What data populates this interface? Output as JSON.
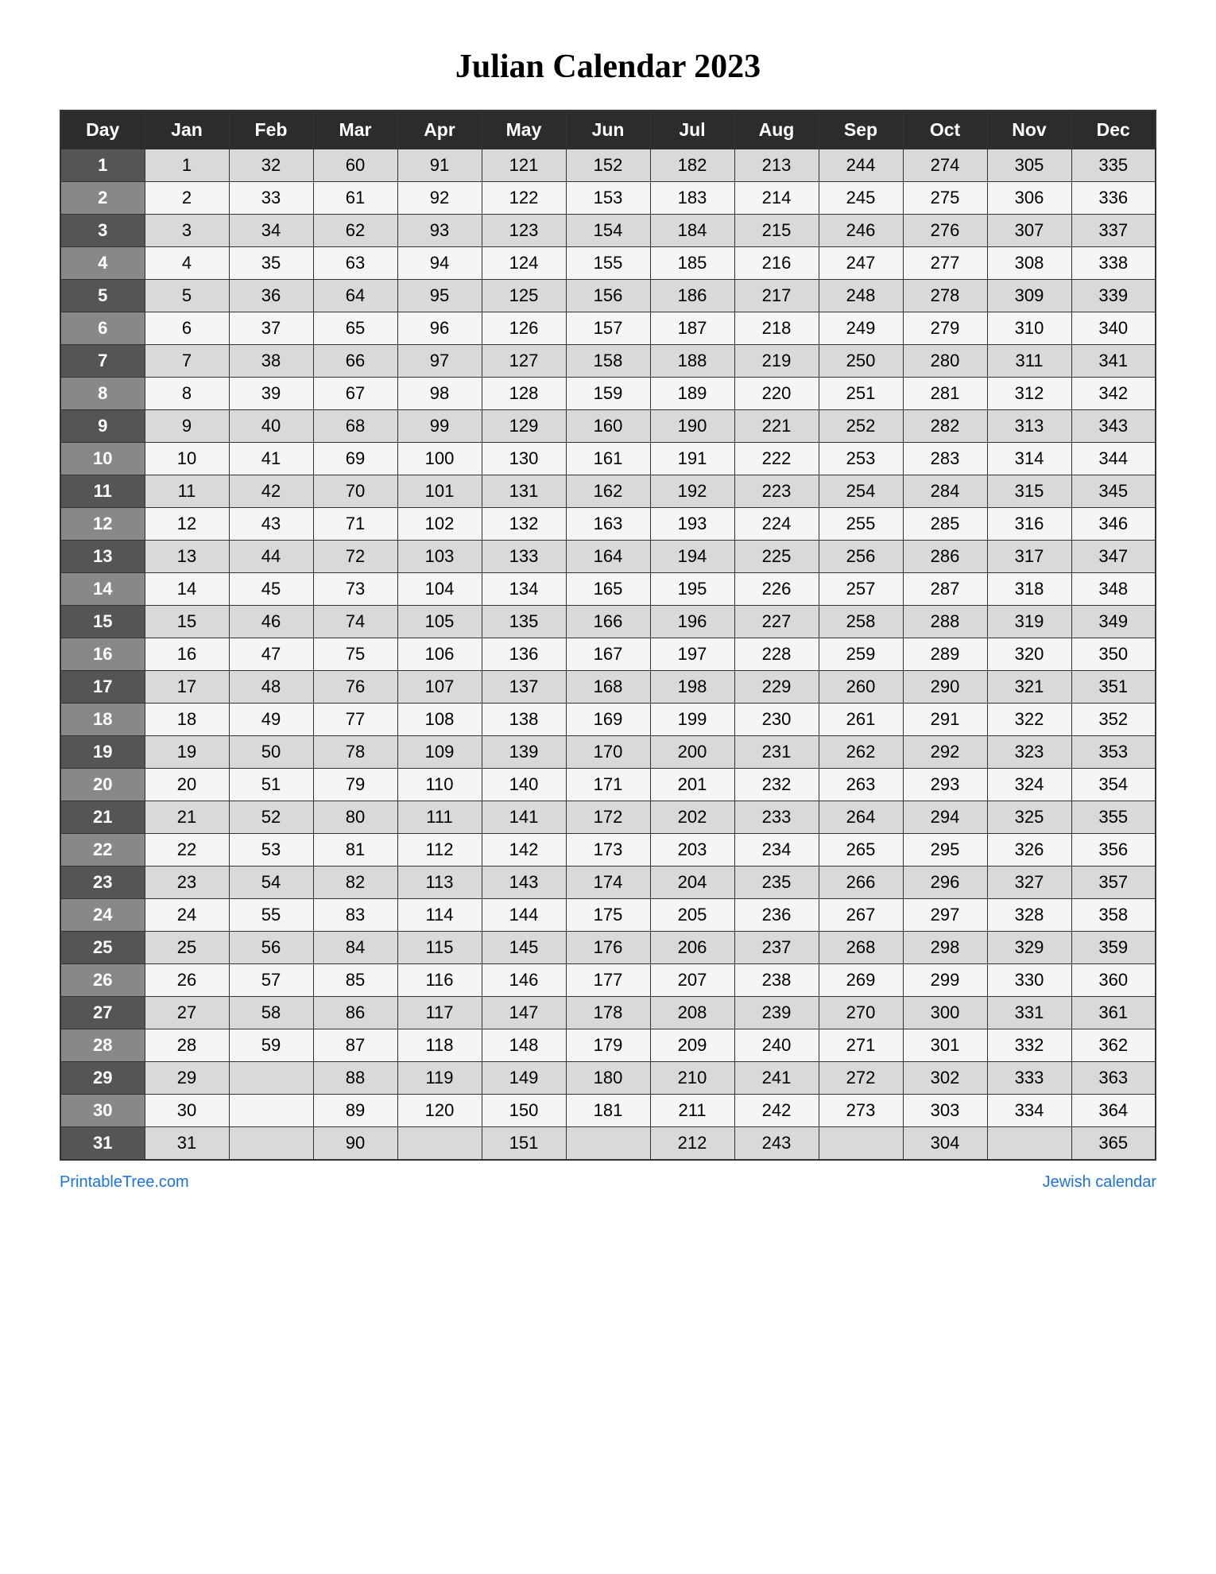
{
  "title": "Julian Calendar 2023",
  "headers": [
    "Day",
    "Jan",
    "Feb",
    "Mar",
    "Apr",
    "May",
    "Jun",
    "Jul",
    "Aug",
    "Sep",
    "Oct",
    "Nov",
    "Dec"
  ],
  "rows": [
    [
      1,
      1,
      32,
      60,
      91,
      121,
      152,
      182,
      213,
      244,
      274,
      305,
      335
    ],
    [
      2,
      2,
      33,
      61,
      92,
      122,
      153,
      183,
      214,
      245,
      275,
      306,
      336
    ],
    [
      3,
      3,
      34,
      62,
      93,
      123,
      154,
      184,
      215,
      246,
      276,
      307,
      337
    ],
    [
      4,
      4,
      35,
      63,
      94,
      124,
      155,
      185,
      216,
      247,
      277,
      308,
      338
    ],
    [
      5,
      5,
      36,
      64,
      95,
      125,
      156,
      186,
      217,
      248,
      278,
      309,
      339
    ],
    [
      6,
      6,
      37,
      65,
      96,
      126,
      157,
      187,
      218,
      249,
      279,
      310,
      340
    ],
    [
      7,
      7,
      38,
      66,
      97,
      127,
      158,
      188,
      219,
      250,
      280,
      311,
      341
    ],
    [
      8,
      8,
      39,
      67,
      98,
      128,
      159,
      189,
      220,
      251,
      281,
      312,
      342
    ],
    [
      9,
      9,
      40,
      68,
      99,
      129,
      160,
      190,
      221,
      252,
      282,
      313,
      343
    ],
    [
      10,
      10,
      41,
      69,
      100,
      130,
      161,
      191,
      222,
      253,
      283,
      314,
      344
    ],
    [
      11,
      11,
      42,
      70,
      101,
      131,
      162,
      192,
      223,
      254,
      284,
      315,
      345
    ],
    [
      12,
      12,
      43,
      71,
      102,
      132,
      163,
      193,
      224,
      255,
      285,
      316,
      346
    ],
    [
      13,
      13,
      44,
      72,
      103,
      133,
      164,
      194,
      225,
      256,
      286,
      317,
      347
    ],
    [
      14,
      14,
      45,
      73,
      104,
      134,
      165,
      195,
      226,
      257,
      287,
      318,
      348
    ],
    [
      15,
      15,
      46,
      74,
      105,
      135,
      166,
      196,
      227,
      258,
      288,
      319,
      349
    ],
    [
      16,
      16,
      47,
      75,
      106,
      136,
      167,
      197,
      228,
      259,
      289,
      320,
      350
    ],
    [
      17,
      17,
      48,
      76,
      107,
      137,
      168,
      198,
      229,
      260,
      290,
      321,
      351
    ],
    [
      18,
      18,
      49,
      77,
      108,
      138,
      169,
      199,
      230,
      261,
      291,
      322,
      352
    ],
    [
      19,
      19,
      50,
      78,
      109,
      139,
      170,
      200,
      231,
      262,
      292,
      323,
      353
    ],
    [
      20,
      20,
      51,
      79,
      110,
      140,
      171,
      201,
      232,
      263,
      293,
      324,
      354
    ],
    [
      21,
      21,
      52,
      80,
      111,
      141,
      172,
      202,
      233,
      264,
      294,
      325,
      355
    ],
    [
      22,
      22,
      53,
      81,
      112,
      142,
      173,
      203,
      234,
      265,
      295,
      326,
      356
    ],
    [
      23,
      23,
      54,
      82,
      113,
      143,
      174,
      204,
      235,
      266,
      296,
      327,
      357
    ],
    [
      24,
      24,
      55,
      83,
      114,
      144,
      175,
      205,
      236,
      267,
      297,
      328,
      358
    ],
    [
      25,
      25,
      56,
      84,
      115,
      145,
      176,
      206,
      237,
      268,
      298,
      329,
      359
    ],
    [
      26,
      26,
      57,
      85,
      116,
      146,
      177,
      207,
      238,
      269,
      299,
      330,
      360
    ],
    [
      27,
      27,
      58,
      86,
      117,
      147,
      178,
      208,
      239,
      270,
      300,
      331,
      361
    ],
    [
      28,
      28,
      59,
      87,
      118,
      148,
      179,
      209,
      240,
      271,
      301,
      332,
      362
    ],
    [
      29,
      29,
      null,
      88,
      119,
      149,
      180,
      210,
      241,
      272,
      302,
      333,
      363
    ],
    [
      30,
      30,
      null,
      89,
      120,
      150,
      181,
      211,
      242,
      273,
      303,
      334,
      364
    ],
    [
      31,
      31,
      null,
      90,
      null,
      151,
      null,
      212,
      243,
      null,
      304,
      null,
      365
    ]
  ],
  "footer": {
    "left_link_text": "PrintableTree.com",
    "left_link_url": "#",
    "right_link_text": "Jewish calendar",
    "right_link_url": "#"
  }
}
